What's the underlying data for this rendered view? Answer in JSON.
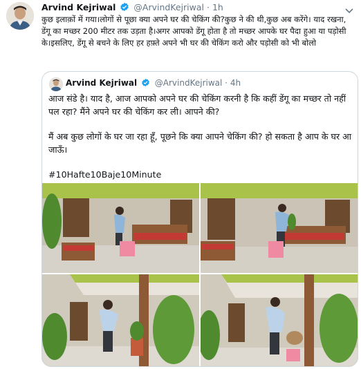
{
  "tweet": {
    "author_name": "Arvind Kejriwal",
    "author_handle": "@ArvindKejriwal",
    "separator": "·",
    "time": "1h",
    "text": "कुछ इलाक़ों में गया।लोगों से पूछा क्या अपने घर की चेकिंग की?कुछ ने की थी,कुछ अब करेंगे। याद रखना, डेंगू का मच्छर 200 मीटर तक उड़ता है।अगर आपको डेंगू होता है तो मच्छर आपके घर पैदा हुआ या पड़ोसी के।इसलिए, डेंगू से बचने के लिए हर हफ़्ते अपने भी घर की चेकिंग करो और पड़ोसी को भी बोलो"
  },
  "quoted": {
    "author_name": "Arvind Kejriwal",
    "author_handle": "@ArvindKejriwal",
    "separator": "·",
    "time": "4h",
    "paragraph1": "आज संडे है। याद है, आज आपको अपने घर की चेकिंग करनी है कि कहीं डेंगू का मच्छर तो नहीं पल रहा? मैंने अपने घर की चेकिंग कर ली। आपने की?",
    "paragraph2": "मैं अब कुछ लोगों के घर जा रहा हूँ, पूछने कि क्या आपने चेकिंग की? हो सकता है आप के घर आ जाऊँ।",
    "hashtag": "#10Hafte10Baje10Minute"
  },
  "icons": {
    "verified": "verified-badge-icon",
    "menu": "chevron-down-icon"
  },
  "colors": {
    "text": "#14171a",
    "muted": "#657786",
    "verified": "#1da1f2",
    "border": "#ccd6dd"
  }
}
